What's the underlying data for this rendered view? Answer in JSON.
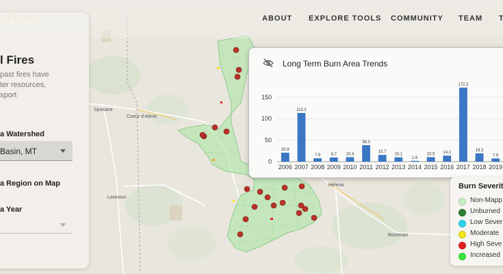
{
  "brand": {
    "logo_text": "oFlame",
    "accent": "#e07b2a"
  },
  "nav": {
    "items": [
      "ABOUT",
      "EXPLORE TOOLS",
      "COMMUNITY",
      "TEAM",
      "T"
    ]
  },
  "map": {
    "cities": [
      "Spokane",
      "Coeur d'Alene",
      "Lewiston",
      "Helena",
      "Bozeman"
    ],
    "marker_color": "#c0392b",
    "watershed_color": "#a8e6a1"
  },
  "left_panel": {
    "title": "l Fires",
    "description_lines": [
      "past fires have",
      "ter resources,",
      "sport"
    ],
    "watershed_label": "a Watershed",
    "watershed_value": "Basin, MT",
    "region_label": "a Region on Map",
    "year_label": "a Year",
    "year_placeholder": "ar"
  },
  "chart_panel": {
    "title": "Long Term Burn Area Trends",
    "toggle_icon": "eye-off-icon"
  },
  "chart_data": {
    "type": "bar",
    "title": "Long Term Burn Area Trends",
    "categories": [
      "2006",
      "2007",
      "2008",
      "2009",
      "2010",
      "2011",
      "2012",
      "2013",
      "2014",
      "2015",
      "2016",
      "2017",
      "2018",
      "2019"
    ],
    "values": [
      20.8,
      113.2,
      7.9,
      9.7,
      10.4,
      38.3,
      15.7,
      10.1,
      1.9,
      10.5,
      14.1,
      172.2,
      19.3,
      7.5
    ],
    "value_labels": [
      "20.8",
      "113.2",
      "7.9",
      "9.7",
      "10.4",
      "38.3",
      "15.7",
      "10.1",
      "1.9",
      "10.5",
      "14.1",
      "172.2",
      "19.3",
      "7.5"
    ],
    "ylim": [
      0,
      180
    ],
    "yticks": [
      0,
      50,
      100,
      150
    ],
    "bar_color": "#3a77c4",
    "grid": true,
    "xlabel": "",
    "ylabel": ""
  },
  "legend": {
    "title": "Burn Severit",
    "items": [
      {
        "label": "Non-Mapp",
        "color": "#c9f0c4"
      },
      {
        "label": "Unburned",
        "color": "#2e7d32"
      },
      {
        "label": "Low Sever",
        "color": "#29d5e8"
      },
      {
        "label": "Moderate",
        "color": "#f2e51a"
      },
      {
        "label": "High Seve",
        "color": "#e02020"
      },
      {
        "label": "Increased",
        "color": "#39e639"
      }
    ]
  }
}
